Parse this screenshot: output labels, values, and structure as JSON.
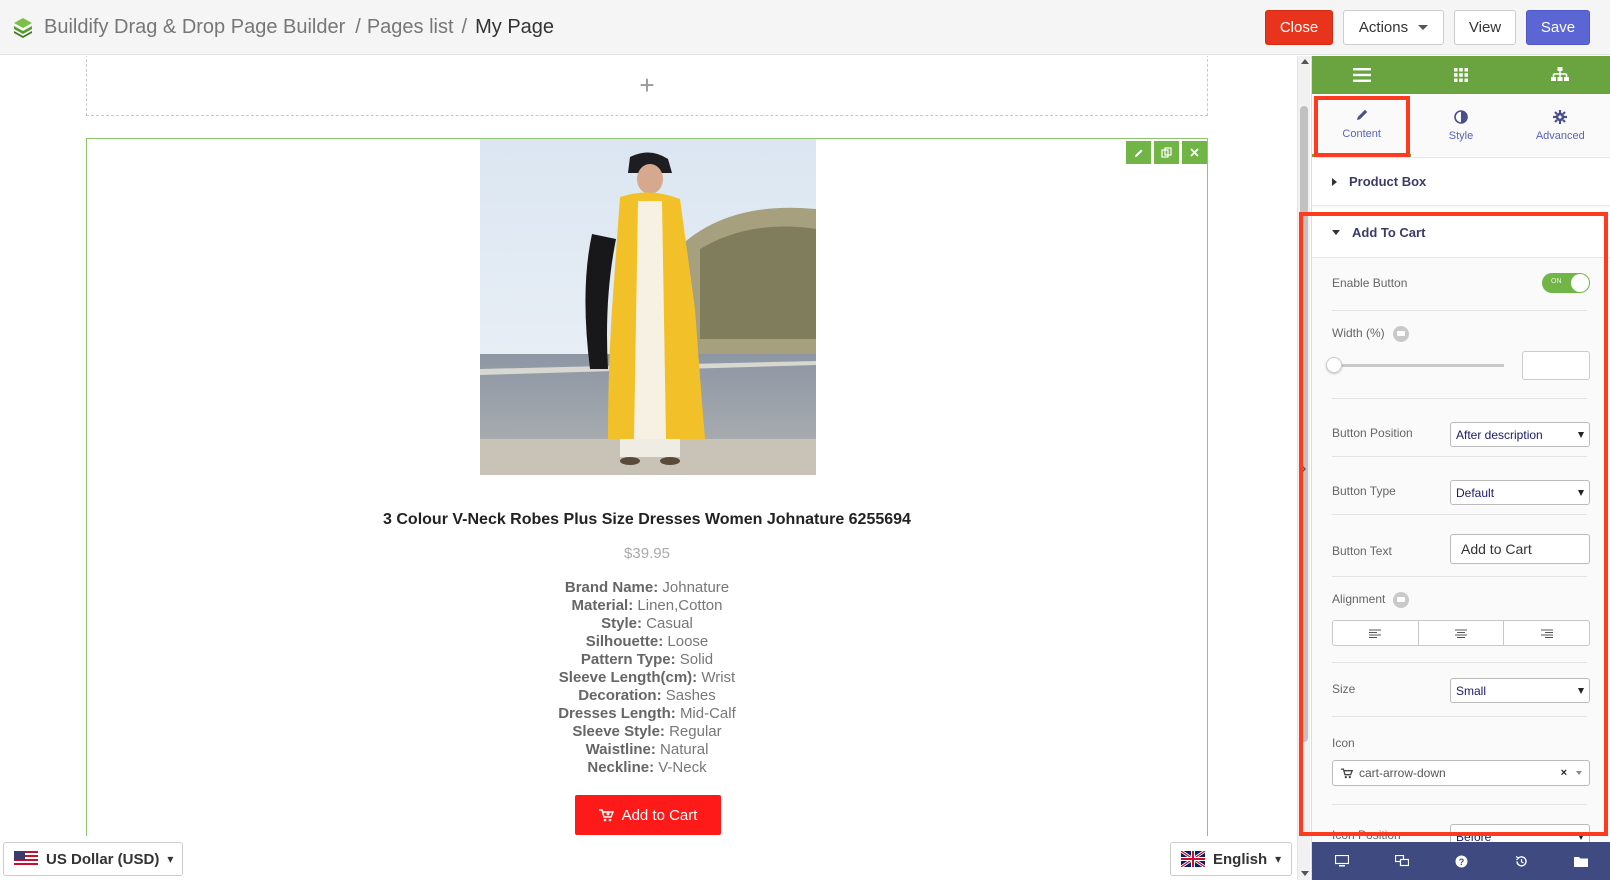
{
  "header": {
    "app_name": "Buildify Drag & Drop Page Builder",
    "sep1": "/",
    "crumb_pages": "Pages list",
    "sep2": "/",
    "current_page": "My Page",
    "close_label": "Close",
    "actions_label": "Actions",
    "view_label": "View",
    "save_label": "Save"
  },
  "canvas": {
    "add_section_symbol": "+",
    "product": {
      "title": "3 Colour V-Neck Robes Plus Size Dresses Women Johnature 6255694",
      "price": "$39.95",
      "attributes": [
        {
          "label": "Brand Name:",
          "value": "Johnature"
        },
        {
          "label": "Material:",
          "value": "Linen,Cotton"
        },
        {
          "label": "Style:",
          "value": "Casual"
        },
        {
          "label": "Silhouette:",
          "value": "Loose"
        },
        {
          "label": "Pattern Type:",
          "value": "Solid"
        },
        {
          "label": "Sleeve Length(cm):",
          "value": "Wrist"
        },
        {
          "label": "Decoration:",
          "value": "Sashes"
        },
        {
          "label": "Dresses Length:",
          "value": "Mid-Calf"
        },
        {
          "label": "Sleeve Style:",
          "value": "Regular"
        },
        {
          "label": "Waistline:",
          "value": "Natural"
        },
        {
          "label": "Neckline:",
          "value": "V-Neck"
        }
      ],
      "button_label": "Add to Cart"
    }
  },
  "footer": {
    "currency": "US Dollar (USD)",
    "language": "English"
  },
  "panel": {
    "tabs": [
      {
        "label": "Content"
      },
      {
        "label": "Style"
      },
      {
        "label": "Advanced"
      }
    ],
    "sections": {
      "product_box": "Product Box",
      "add_to_cart": "Add To Cart"
    },
    "controls": {
      "enable_button_label": "Enable Button",
      "toggle_text": "ON",
      "width_label": "Width (%)",
      "button_position_label": "Button Position",
      "button_position_value": "After description",
      "button_type_label": "Button Type",
      "button_type_value": "Default",
      "button_text_label": "Button Text",
      "button_text_value": "Add to Cart",
      "alignment_label": "Alignment",
      "size_label": "Size",
      "size_value": "Small",
      "icon_label": "Icon",
      "icon_value": "cart-arrow-down",
      "icon_clear": "×",
      "icon_position_label": "Icon Position",
      "icon_position_value": "Before"
    }
  },
  "colors": {
    "panel_green": "#6aa440",
    "panel_footer": "#3e4a80",
    "close_red": "#e8341c",
    "save_blue": "#5b65d4",
    "cart_button": "#ff1a1a",
    "highlight": "#ff3b1f"
  }
}
